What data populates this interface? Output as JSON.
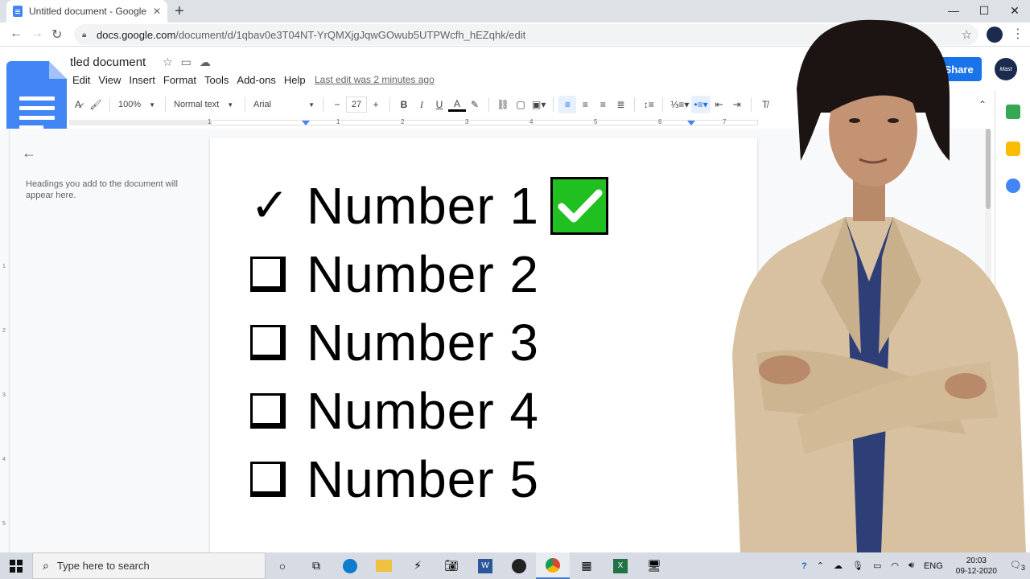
{
  "browser": {
    "tab_title": "Untitled document - Google Doc",
    "tab_close": "✕",
    "new_tab": "+",
    "window_controls": {
      "minimize": "—",
      "maximize": "☐",
      "close": "✕"
    },
    "url_host": "docs.google.com",
    "url_path": "/document/d/1qbav0e3T04NT-YrQMXjgJqwGOwub5UTPWcfh_hEZqhk/edit"
  },
  "docs": {
    "title": "tled document",
    "menu": [
      "Edit",
      "View",
      "Insert",
      "Format",
      "Tools",
      "Add-ons",
      "Help"
    ],
    "last_edit": "Last edit was 2 minutes ago",
    "share_label": "Share",
    "account_label": "Mast",
    "toolbar": {
      "zoom": "100%",
      "style": "Normal text",
      "font": "Arial",
      "font_size": "27",
      "minus": "−",
      "plus": "+",
      "bold": "B",
      "italic": "I",
      "underline": "U",
      "text_color": "A"
    },
    "ruler_numbers": [
      "1",
      "1",
      "2",
      "3",
      "4",
      "5",
      "6",
      "7"
    ],
    "vruler_numbers": [
      "1",
      "2",
      "3",
      "4",
      "5"
    ],
    "outline_hint": "Headings you add to the document will appear here."
  },
  "document": {
    "items": [
      {
        "label": "Number 1",
        "checked": true,
        "check_glyph": "✓"
      },
      {
        "label": "Number 2",
        "checked": false
      },
      {
        "label": "Number 3",
        "checked": false
      },
      {
        "label": "Number 4",
        "checked": false
      },
      {
        "label": "Number 5",
        "checked": false
      }
    ]
  },
  "taskbar": {
    "search_placeholder": "Type here to search",
    "language": "ENG",
    "time": "20:03",
    "date": "09-12-2020",
    "notification_count": "3"
  },
  "colors": {
    "accent": "#1a73e8",
    "docs_blue": "#4285f4",
    "green_check": "#20c020",
    "taskbar": "#d6dbe4"
  }
}
